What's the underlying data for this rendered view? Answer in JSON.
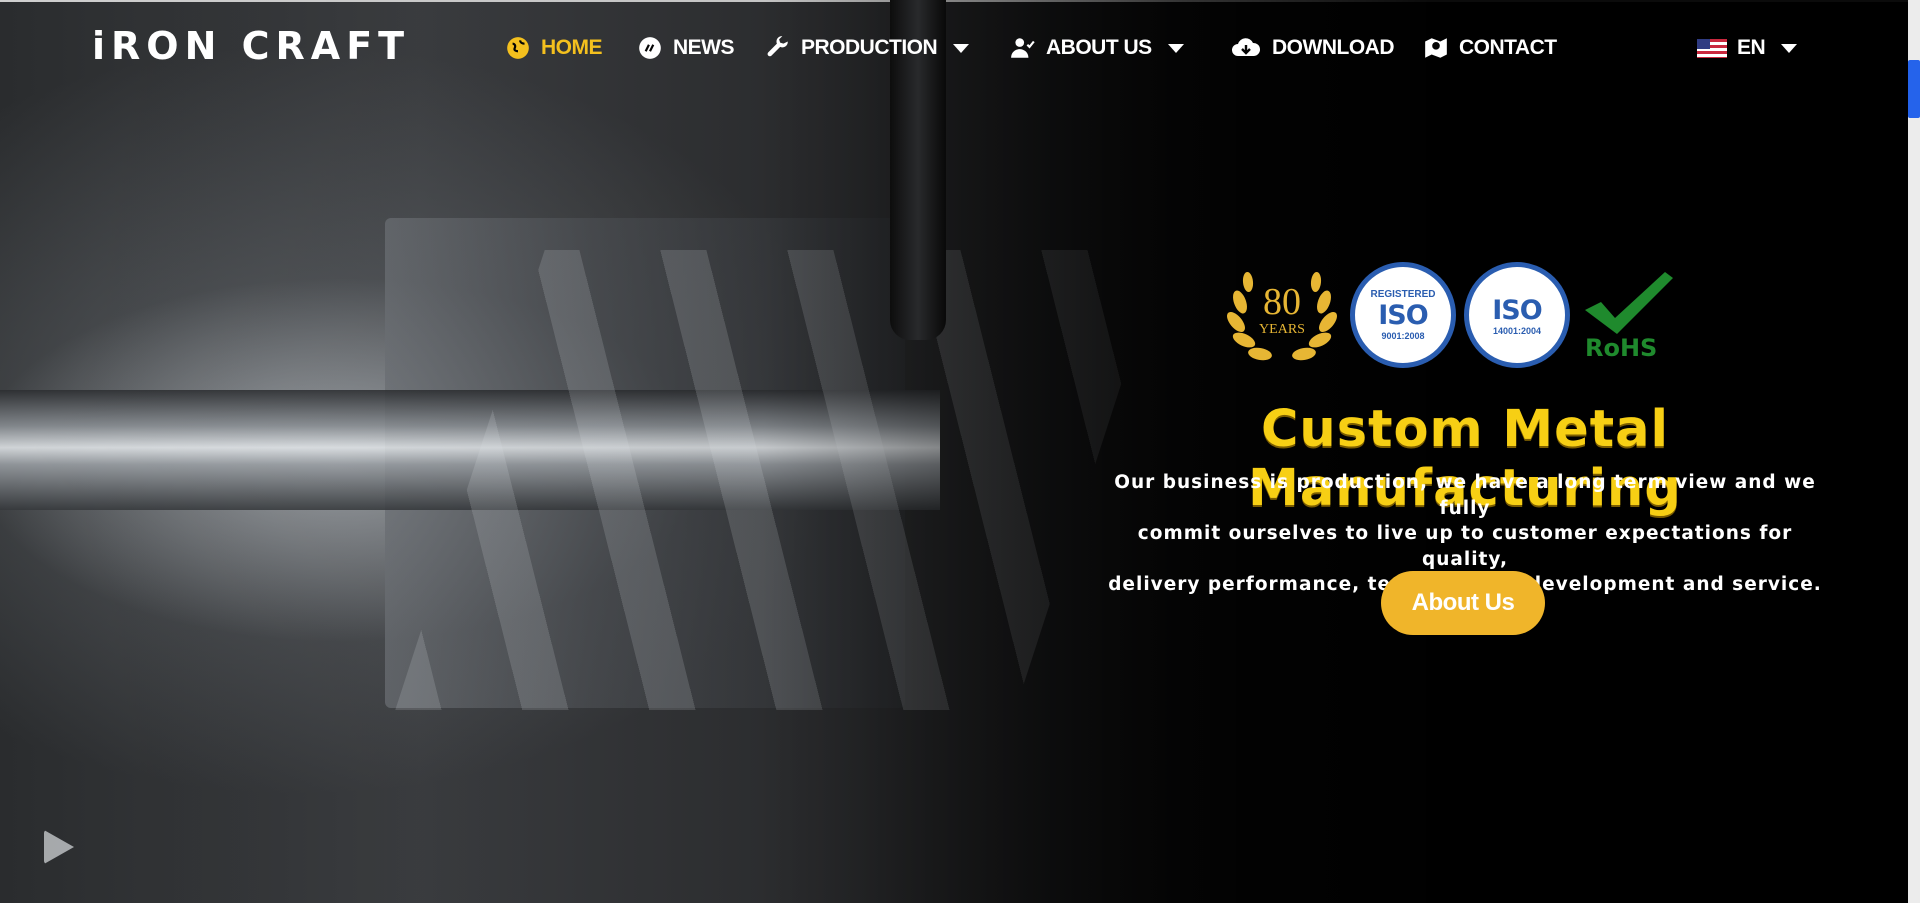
{
  "brand": {
    "logo_text_1": "iRON",
    "logo_text_2": "CRAFT"
  },
  "nav": {
    "items": [
      {
        "label": "HOME",
        "icon": "globe-icon",
        "active": true
      },
      {
        "label": "NEWS",
        "icon": "news-icon"
      },
      {
        "label": "PRODUCTION",
        "icon": "wrench-icon",
        "dropdown": true
      },
      {
        "label": "ABOUT US",
        "icon": "user-check-icon",
        "dropdown": true
      },
      {
        "label": "DOWNLOAD",
        "icon": "cloud-download-icon"
      },
      {
        "label": "CONTACT",
        "icon": "map-marker-icon"
      }
    ],
    "language": {
      "label": "EN",
      "icon": "us-flag-icon"
    }
  },
  "hero": {
    "badges": {
      "years_number": "80",
      "years_label": "YEARS",
      "iso1_top": "REGISTERED",
      "iso1_main": "ISO",
      "iso1_code": "9001:2008",
      "iso2_main": "ISO",
      "iso2_code": "14001:2004",
      "rohs": "RoHS"
    },
    "title": "Custom Metal Manufacturing",
    "description_lines": [
      "Our business is production, we have a long term view and we fully",
      "commit ourselves to live up to customer expectations for quality,",
      "delivery performance, technological development and service."
    ],
    "cta_label": "About Us"
  },
  "colors": {
    "accent": "#f4c01e",
    "button": "#f0b52a",
    "iso_blue": "#2a5db0",
    "rohs_green": "#1f8a2d"
  }
}
